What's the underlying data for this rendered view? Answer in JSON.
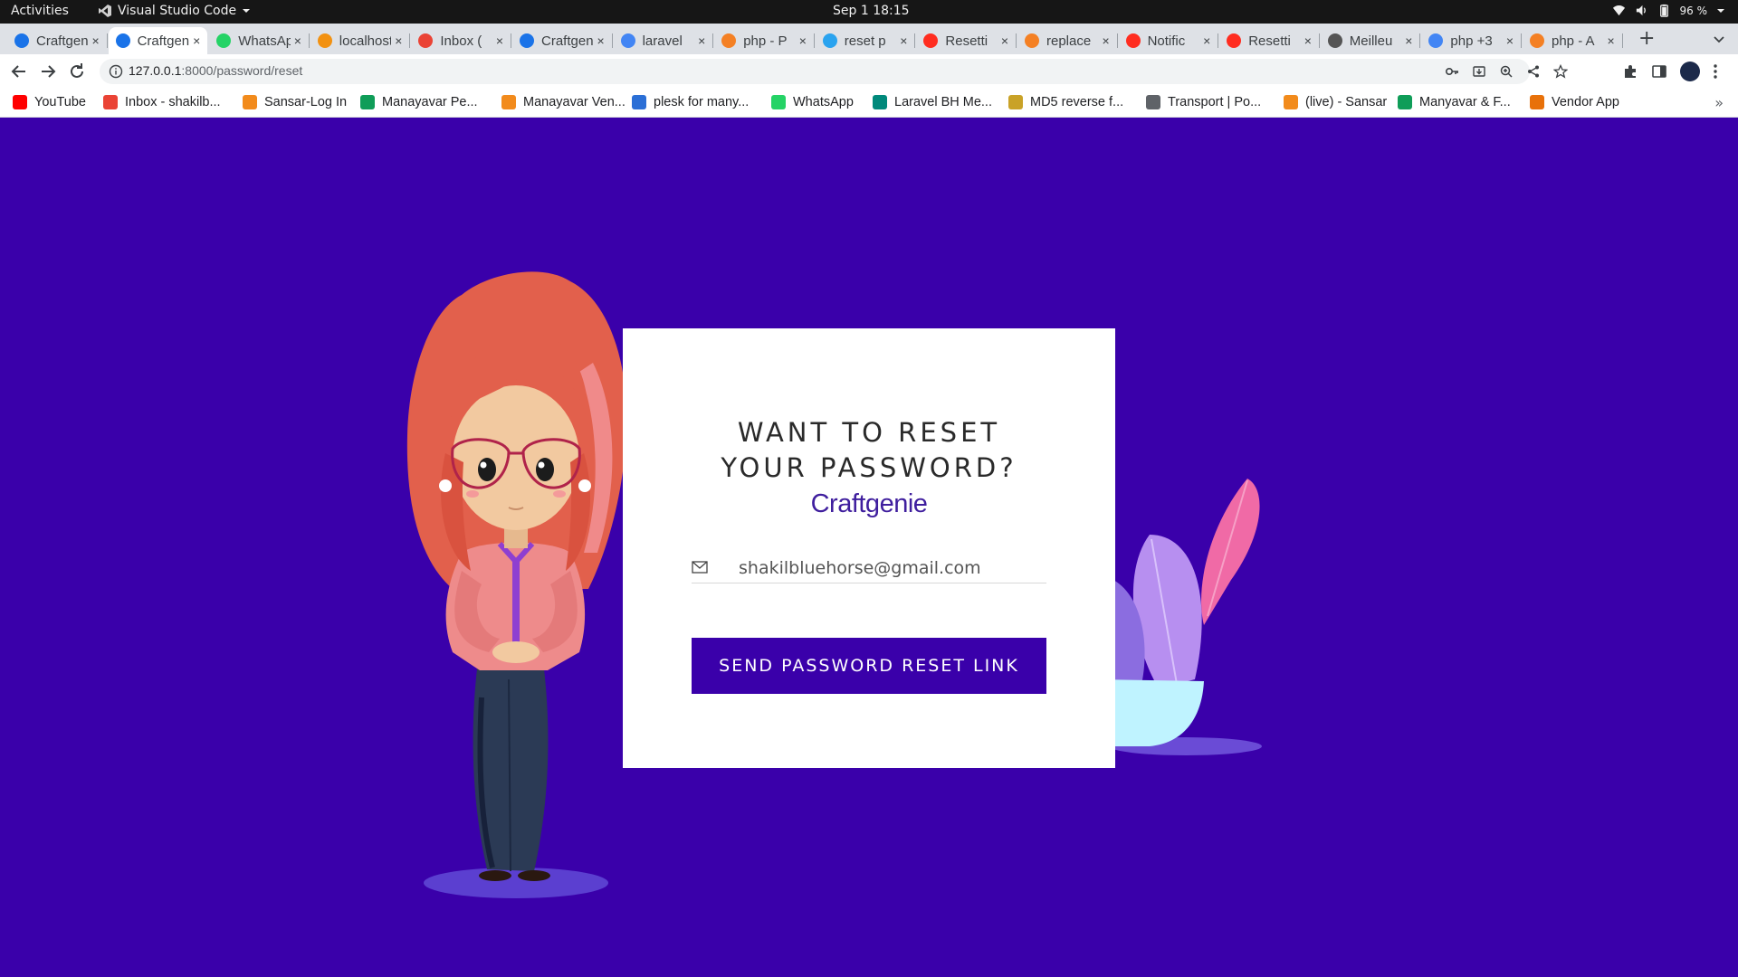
{
  "system_bar": {
    "activities": "Activities",
    "app_name": "Visual Studio Code",
    "clock": "Sep 1  18:15",
    "battery": "96 %"
  },
  "tabs": [
    {
      "label": "Craftgenie",
      "icon": "craftgenie-icon",
      "color": "#1a73e8",
      "active": false
    },
    {
      "label": "Craftgenie",
      "icon": "craftgenie-icon",
      "color": "#1a73e8",
      "active": true
    },
    {
      "label": "WhatsApp",
      "icon": "whatsapp-icon",
      "color": "#25d366",
      "active": false
    },
    {
      "label": "localhost",
      "icon": "phpmyadmin-icon",
      "color": "#f29111",
      "active": false
    },
    {
      "label": "Inbox (",
      "icon": "gmail-icon",
      "color": "#ea4335",
      "active": false
    },
    {
      "label": "Craftgenie",
      "icon": "craftgenie-icon",
      "color": "#1a73e8",
      "active": false
    },
    {
      "label": "laravel",
      "icon": "google-icon",
      "color": "#4285f4",
      "active": false
    },
    {
      "label": "php - P",
      "icon": "stackoverflow-icon",
      "color": "#f48024",
      "active": false
    },
    {
      "label": "reset p",
      "icon": "telegram-icon",
      "color": "#2aa3ef",
      "active": false
    },
    {
      "label": "Resetti",
      "icon": "laravel-icon",
      "color": "#ff2d20",
      "active": false
    },
    {
      "label": "replace",
      "icon": "stackoverflow-icon",
      "color": "#f48024",
      "active": false
    },
    {
      "label": "Notific",
      "icon": "laravel-icon",
      "color": "#ff2d20",
      "active": false
    },
    {
      "label": "Resetti",
      "icon": "laravel-icon",
      "color": "#ff2d20",
      "active": false
    },
    {
      "label": "Meilleu",
      "icon": "site-icon",
      "color": "#555555",
      "active": false
    },
    {
      "label": "php +3",
      "icon": "google-icon",
      "color": "#4285f4",
      "active": false
    },
    {
      "label": "php - A",
      "icon": "stackoverflow-icon",
      "color": "#f48024",
      "active": false
    }
  ],
  "address_bar": {
    "host": "127.0.0.1",
    "path": ":8000/password/reset"
  },
  "bookmarks": [
    {
      "label": "YouTube",
      "icon": "youtube-icon",
      "color": "#ff0000"
    },
    {
      "label": "Inbox - shakilb...",
      "icon": "gmail-icon",
      "color": "#ea4335"
    },
    {
      "label": "Sansar-Log In",
      "icon": "sansar-icon",
      "color": "#f28b1c"
    },
    {
      "label": "Manayavar Pe...",
      "icon": "sheets-icon",
      "color": "#0f9d58"
    },
    {
      "label": "Manayavar Ven...",
      "icon": "sansar-icon",
      "color": "#f28b1c"
    },
    {
      "label": "plesk for many...",
      "icon": "plesk-icon",
      "color": "#2b6fd6"
    },
    {
      "label": "WhatsApp",
      "icon": "whatsapp-icon",
      "color": "#25d366"
    },
    {
      "label": "Laravel BH Me...",
      "icon": "meet-icon",
      "color": "#00897b"
    },
    {
      "label": "MD5 reverse f...",
      "icon": "key-icon",
      "color": "#c9a227"
    },
    {
      "label": "Transport | Po...",
      "icon": "globe-icon",
      "color": "#5f6368"
    },
    {
      "label": "(live) - Sansar",
      "icon": "sansar-icon",
      "color": "#f28b1c"
    },
    {
      "label": "Manyavar & F...",
      "icon": "sheets-icon",
      "color": "#0f9d58"
    },
    {
      "label": "Vendor App",
      "icon": "calendar-icon",
      "color": "#e8710a"
    }
  ],
  "page": {
    "background": "#3a00aa",
    "title_line1": "WANT TO RESET",
    "title_line2": "YOUR PASSWORD?",
    "brand": "Craftgenie",
    "email_value": "shakilbluehorse@gmail.com",
    "button_label": "SEND PASSWORD RESET LINK"
  }
}
